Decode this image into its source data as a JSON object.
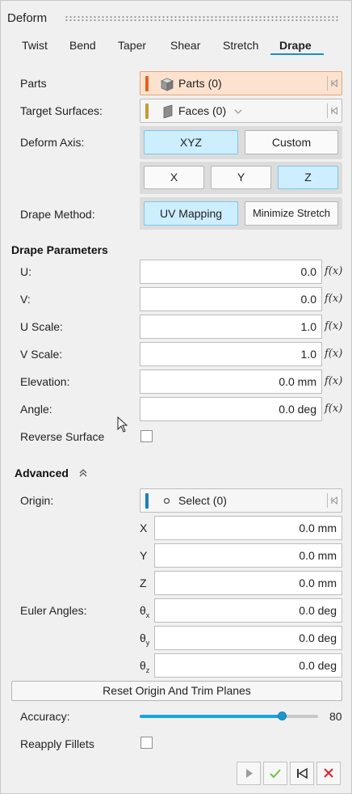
{
  "panel": {
    "title": "Deform"
  },
  "tabs": [
    {
      "label": "Twist",
      "active": false
    },
    {
      "label": "Bend",
      "active": false
    },
    {
      "label": "Taper",
      "active": false
    },
    {
      "label": "Shear",
      "active": false
    },
    {
      "label": "Stretch",
      "active": false
    },
    {
      "label": "Drape",
      "active": true
    }
  ],
  "parts": {
    "label": "Parts",
    "value": "Parts (0)",
    "bar_color": "#e8601c"
  },
  "target_surfaces": {
    "label": "Target Surfaces:",
    "value": "Faces (0)",
    "bar_color": "#c99a2e"
  },
  "deform_axis": {
    "label": "Deform Axis:",
    "modes": [
      {
        "label": "XYZ",
        "selected": true
      },
      {
        "label": "Custom",
        "selected": false
      }
    ],
    "axes": [
      {
        "label": "X",
        "selected": false
      },
      {
        "label": "Y",
        "selected": false
      },
      {
        "label": "Z",
        "selected": true
      }
    ]
  },
  "drape_method": {
    "label": "Drape Method:",
    "options": [
      {
        "label": "UV Mapping",
        "selected": true
      },
      {
        "label": "Minimize Stretch",
        "selected": false
      }
    ]
  },
  "drape_params": {
    "heading": "Drape Parameters",
    "fx_label": "f(x)",
    "rows": [
      {
        "label": "U:",
        "value": "0.0"
      },
      {
        "label": "V:",
        "value": "0.0"
      },
      {
        "label": "U Scale:",
        "value": "1.0"
      },
      {
        "label": "V Scale:",
        "value": "1.0"
      },
      {
        "label": "Elevation:",
        "value": "0.0 mm"
      },
      {
        "label": "Angle:",
        "value": "0.0 deg"
      }
    ],
    "reverse_surface": {
      "label": "Reverse Surface",
      "checked": false
    }
  },
  "advanced": {
    "heading": "Advanced",
    "origin": {
      "label": "Origin:",
      "value": "Select (0)",
      "bar_color": "#1c7fc0"
    },
    "coords": [
      {
        "label": "X",
        "value": "0.0 mm"
      },
      {
        "label": "Y",
        "value": "0.0 mm"
      },
      {
        "label": "Z",
        "value": "0.0 mm"
      }
    ],
    "euler_label": "Euler Angles:",
    "euler": [
      {
        "symbol": "θ",
        "sub": "x",
        "value": "0.0 deg"
      },
      {
        "symbol": "θ",
        "sub": "y",
        "value": "0.0 deg"
      },
      {
        "symbol": "θ",
        "sub": "z",
        "value": "0.0 deg"
      }
    ],
    "reset_button": "Reset Origin And Trim Planes"
  },
  "accuracy": {
    "label": "Accuracy:",
    "value": 80,
    "min": 0,
    "max": 100,
    "value_text": "80"
  },
  "reapply_fillets": {
    "label": "Reapply Fillets",
    "checked": false
  },
  "footer": {
    "icons": [
      "play-icon",
      "check-icon",
      "reset-icon",
      "close-icon"
    ]
  },
  "colors": {
    "accent": "#1a8ec8",
    "selected_button": "#cdeeff",
    "active_selector": "#fde2cf",
    "check": "#6cc24a",
    "close": "#d9262e"
  }
}
